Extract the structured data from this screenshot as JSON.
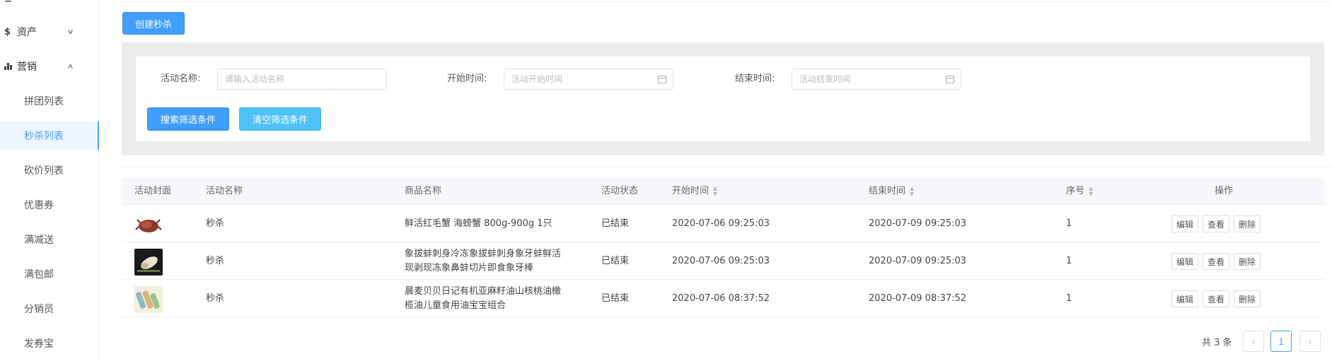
{
  "sidebar": {
    "asset_icon": "$",
    "asset_label": "资产",
    "marketing_label": "营销",
    "items": [
      {
        "label": "拼团列表"
      },
      {
        "label": "秒杀列表"
      },
      {
        "label": "砍价列表"
      },
      {
        "label": "优惠券"
      },
      {
        "label": "满减送"
      },
      {
        "label": "满包邮"
      },
      {
        "label": "分销员"
      },
      {
        "label": "发券宝"
      }
    ],
    "active_index": 1
  },
  "toolbar": {
    "create_label": "创建秒杀"
  },
  "filter": {
    "name_label": "活动名称:",
    "name_placeholder": "请输入活动名称",
    "start_label": "开始时间:",
    "start_placeholder": "活动开始时间",
    "end_label": "结束时间:",
    "end_placeholder": "活动结束时间",
    "search_label": "搜索筛选条件",
    "clear_label": "清空筛选条件"
  },
  "table": {
    "columns": {
      "cover": "活动封面",
      "name": "活动名称",
      "product": "商品名称",
      "status": "活动状态",
      "start": "开始时间",
      "end": "结束时间",
      "order": "序号",
      "ops": "操作"
    },
    "rows": [
      {
        "thumb": "crab",
        "name": "秒杀",
        "product": "鲜活红毛蟹 海螃蟹 800g-900g 1只",
        "status": "已结束",
        "start": "2020-07-06 09:25:03",
        "end": "2020-07-09 09:25:03",
        "order": "1"
      },
      {
        "thumb": "geoduck",
        "name": "秒杀",
        "product": "象拔蚌刺身冷冻象拔蚌刺身象牙蚌鲜活现剥现冻象鼻蚌切片即食象牙棒",
        "product_line1": "象拔蚌刺身冷冻象拔蚌刺身象牙蚌鲜活",
        "product_line2": "现剥现冻象鼻蚌切片即食象牙棒",
        "status": "已结束",
        "start": "2020-07-06 09:25:03",
        "end": "2020-07-09 09:25:03",
        "order": "1"
      },
      {
        "thumb": "oil",
        "name": "秒杀",
        "product": "晨麦贝贝日记有机亚麻籽油山核桃油橄榄油儿童食用油宝宝组合",
        "product_line1": "晨麦贝贝日记有机亚麻籽油山核桃油橄",
        "product_line2": "榄油儿童食用油宝宝组合",
        "status": "已结束",
        "start": "2020-07-06 08:37:52",
        "end": "2020-07-09 08:37:52",
        "order": "1"
      }
    ],
    "op_edit": "编辑",
    "op_view": "查看",
    "op_delete": "删除"
  },
  "pagination": {
    "total": "共 3 条",
    "prev": "‹",
    "current": "1",
    "next": "›"
  },
  "colors": {
    "accent": "#409eff",
    "info": "#4fc3f7"
  }
}
